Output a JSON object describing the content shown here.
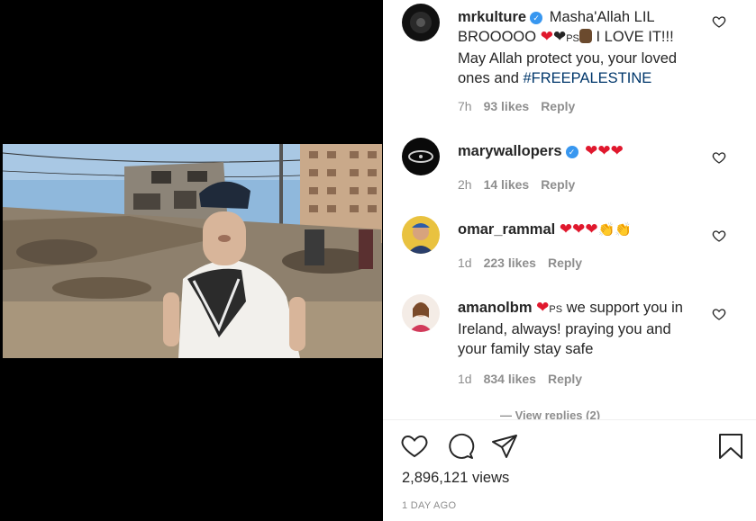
{
  "comments": [
    {
      "username": "mrkulture",
      "verified": true,
      "text_part1": "Masha'Allah LIL BROOOOO",
      "ps": "PS",
      "text_part2": "I LOVE IT!!! May Allah protect you, your loved ones and",
      "hashtag": "#FREEPALESTINE",
      "time": "7h",
      "likes": "93 likes",
      "reply": "Reply"
    },
    {
      "username": "marywallopers",
      "verified": true,
      "time": "2h",
      "likes": "14 likes",
      "reply": "Reply"
    },
    {
      "username": "omar_rammal",
      "verified": false,
      "time": "1d",
      "likes": "223 likes",
      "reply": "Reply"
    },
    {
      "username": "amanolbm",
      "verified": false,
      "ps": "PS",
      "text": "we support you in Ireland, always! praying you and your family stay safe",
      "time": "1d",
      "likes": "834 likes",
      "reply": "Reply"
    }
  ],
  "view_replies": "— View replies (2)",
  "views": "2,896,121 views",
  "date": "1 DAY AGO",
  "colors": {
    "heart": "#e0182d",
    "hashtag": "#00376b",
    "meta": "#8e8e8e",
    "verified": "#3897f0"
  },
  "icons": [
    "like-heart-icon",
    "comment-bubble-icon",
    "share-plane-icon",
    "bookmark-icon",
    "verified-badge-icon"
  ]
}
